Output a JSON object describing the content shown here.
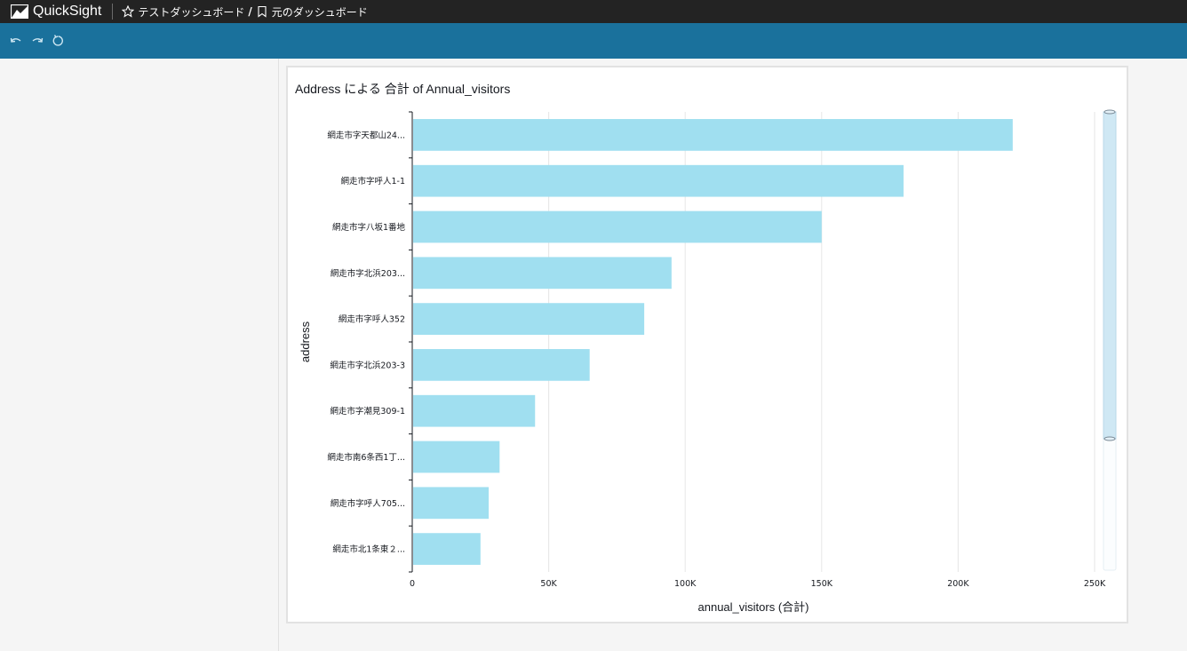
{
  "app": {
    "brand": "QuickSight",
    "logo_icon": "quicksight-logo-icon",
    "breadcrumb": {
      "dashboard": "テストダッシュボード",
      "separator": "/",
      "source": "元のダッシュボード"
    }
  },
  "toolbar": {
    "buttons": [
      {
        "name": "undo-icon"
      },
      {
        "name": "redo-icon"
      },
      {
        "name": "reset-icon"
      }
    ]
  },
  "colors": {
    "topbar": "#232323",
    "toolbar": "#1a719c",
    "bar": "#a0dff0",
    "scrollbar": "#cfe8f4"
  },
  "visual": {
    "title": "Address による 合計 of Annual_visitors"
  },
  "chart_data": {
    "type": "bar",
    "orientation": "horizontal",
    "title": "Address による 合計 of Annual_visitors",
    "xlabel": "annual_visitors (合計)",
    "ylabel": "address",
    "xlim": [
      0,
      250000
    ],
    "xticks": [
      "0",
      "50K",
      "100K",
      "150K",
      "200K",
      "250K"
    ],
    "grid": true,
    "legend": "none",
    "categories": [
      "網走市字天都山24...",
      "網走市字呼人1-1",
      "網走市字八坂1番地",
      "網走市字北浜203...",
      "網走市字呼人352",
      "網走市字北浜203-3",
      "網走市字潮見309-1",
      "網走市南6条西1丁...",
      "網走市字呼人705...",
      "網走市北1条東２..."
    ],
    "values": [
      220000,
      180000,
      150000,
      95000,
      85000,
      65000,
      45000,
      32000,
      28000,
      25000
    ]
  }
}
